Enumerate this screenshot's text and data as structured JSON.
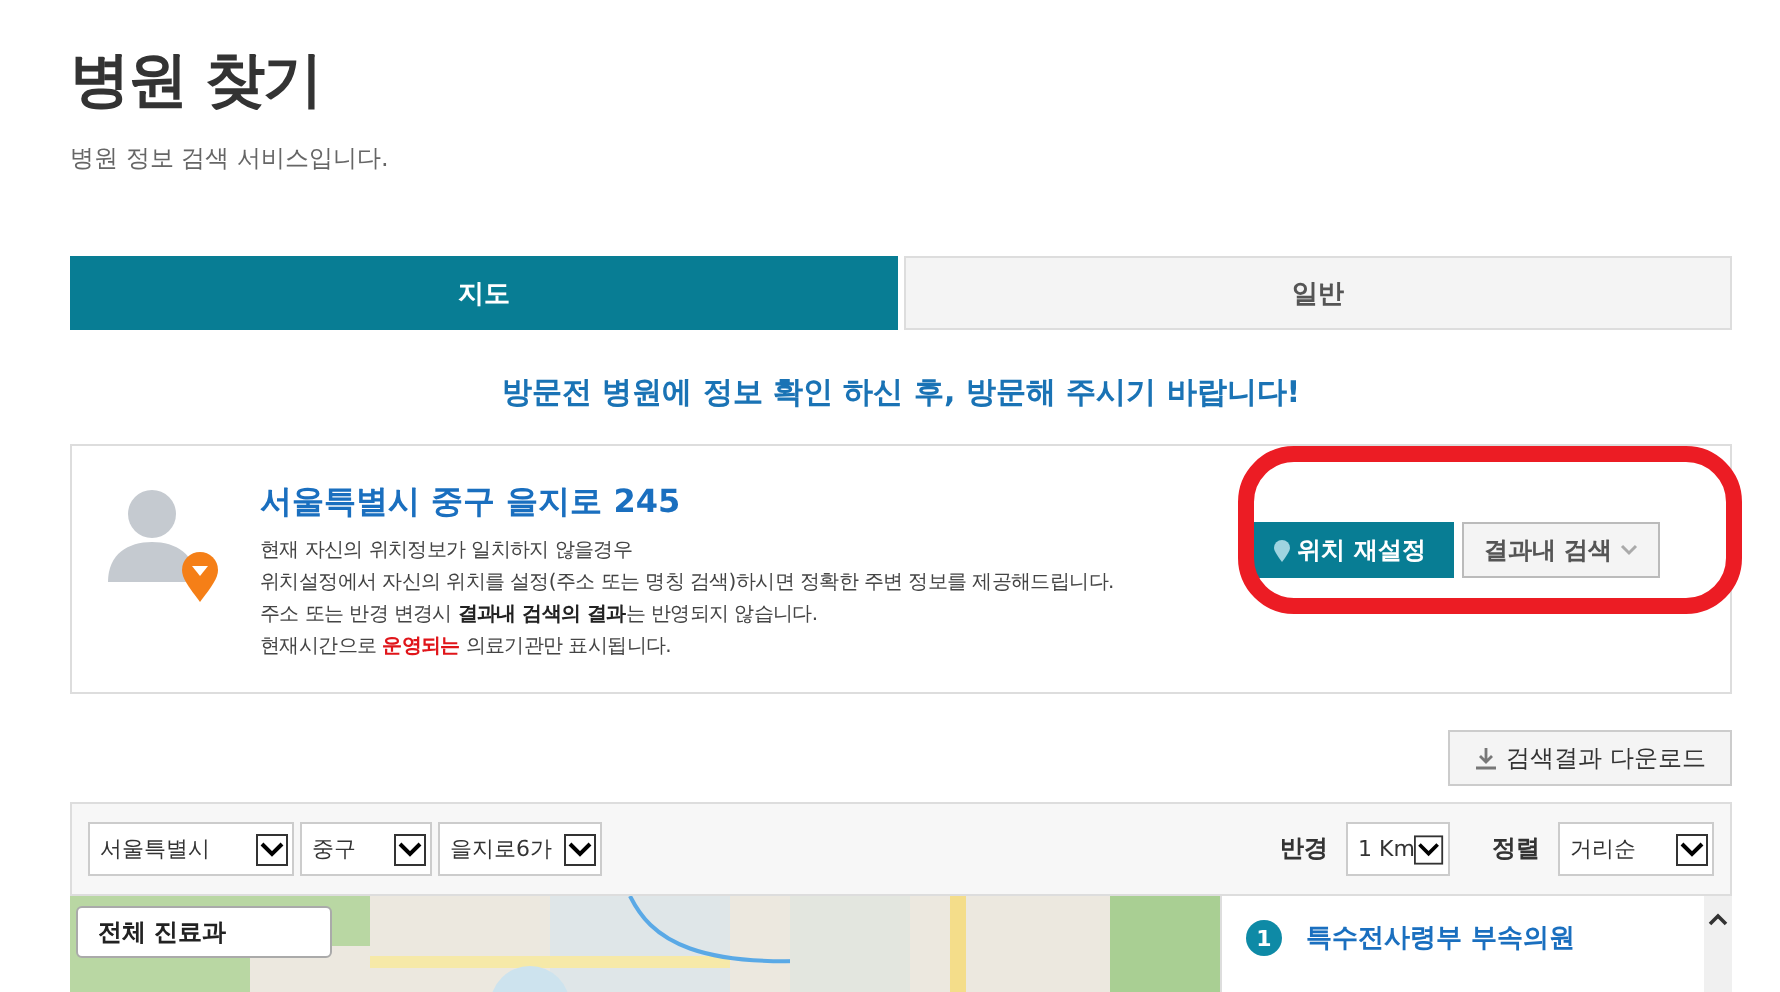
{
  "page": {
    "title": "병원 찾기",
    "subtitle": "병원 정보 검색 서비스입니다."
  },
  "tabs": [
    {
      "label": "지도",
      "selected": true
    },
    {
      "label": "일반",
      "selected": false
    }
  ],
  "notice": "방문전 병원에 정보 확인 하신 후, 방문해 주시기 바랍니다!",
  "location": {
    "address": "서울특별시 중구 을지로 245",
    "lines": [
      "현재 자신의 위치정보가 일치하지 않을경우",
      "위치설정에서 자신의 위치를 설정(주소 또는 명칭 검색)하시면 정확한 주변 정보를 제공해드립니다.",
      "주소 또는 반경 변경시 **결과내 검색의 결과**는 반영되지 않습니다.",
      [
        {
          "text": "현재시간으로 ",
          "kind": "normal"
        },
        {
          "text": "운영되는",
          "kind": "warning"
        },
        {
          "text": " 의료기관만 표시됩니다.",
          "kind": "normal"
        }
      ]
    ],
    "reset_button": "위치 재설정",
    "search_in_results": "결과내 검색",
    "highlighted": true
  },
  "download_button": "검색결과 다운로드",
  "filters": {
    "region": [
      "서울특별시",
      "중구",
      "을지로6가"
    ],
    "radius_label": "반경",
    "radius": "1 Km",
    "sort_label": "정렬",
    "sort": "거리순"
  },
  "map": {
    "kind": "picture",
    "department_button": "전체 진료과"
  },
  "results": [
    {
      "rank": "1",
      "name": "특수전사령부 부속의원"
    }
  ]
}
